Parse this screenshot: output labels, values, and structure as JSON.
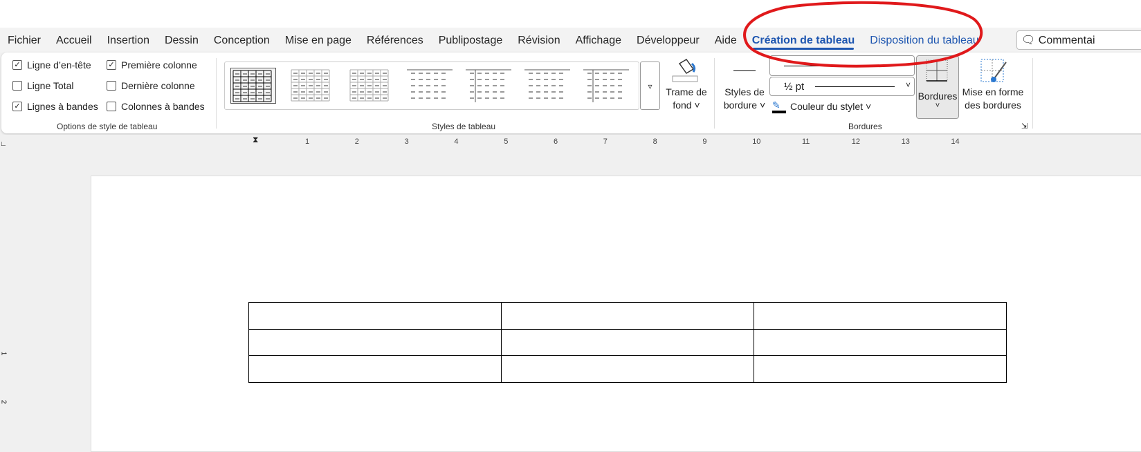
{
  "menu_tabs": [
    "Fichier",
    "Accueil",
    "Insertion",
    "Dessin",
    "Conception",
    "Mise en page",
    "Références",
    "Publipostage",
    "Révision",
    "Affichage",
    "Développeur",
    "Aide"
  ],
  "context_tabs": [
    {
      "label": "Création de tableau",
      "active": true
    },
    {
      "label": "Disposition du tableau",
      "active": false
    }
  ],
  "comment_button": "Commentai",
  "style_options": {
    "group_label": "Options de style de tableau",
    "items": [
      {
        "label": "Ligne d’en-tête",
        "checked": true
      },
      {
        "label": "Ligne Total",
        "checked": false
      },
      {
        "label": "Lignes à bandes",
        "checked": true
      },
      {
        "label": "Première colonne",
        "checked": true
      },
      {
        "label": "Dernière colonne",
        "checked": false
      },
      {
        "label": "Colonnes à bandes",
        "checked": false
      }
    ]
  },
  "table_styles": {
    "group_label": "Styles de tableau",
    "shading_label_1": "Trame de",
    "shading_label_2": "fond ˅"
  },
  "borders": {
    "group_label": "Bordures",
    "border_styles_1": "Styles de",
    "border_styles_2": "bordure ˅",
    "weight": "½ pt",
    "pen_color": "Couleur du stylet ˅",
    "borders_button": "Bordures",
    "painter_1": "Mise en forme",
    "painter_2": "des bordures"
  },
  "ruler_numbers": [
    "1",
    "2",
    "3",
    "4",
    "5",
    "6",
    "7",
    "8",
    "9",
    "10",
    "11",
    "12",
    "13",
    "14"
  ],
  "vruler_numbers": [
    "1",
    "2"
  ],
  "colors": {
    "accent": "#1e56b0",
    "annotation": "#e0191b"
  }
}
